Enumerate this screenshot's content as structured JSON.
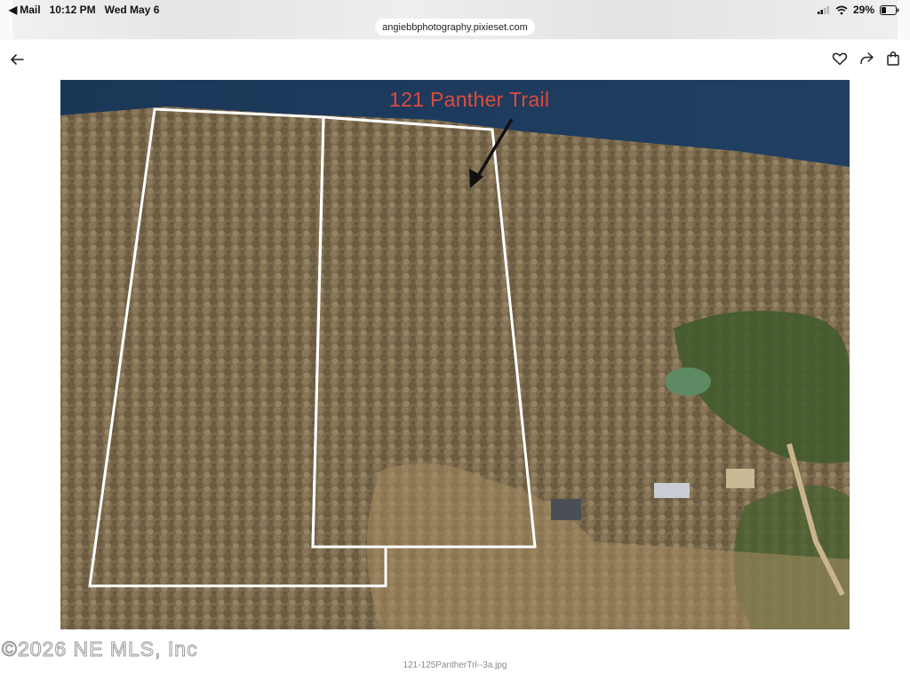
{
  "status_bar": {
    "back_app": "Mail",
    "time": "10:12 PM",
    "date": "Wed May 6",
    "battery": "29%"
  },
  "browser": {
    "url": "angiebbphotography.pixieset.com"
  },
  "icons": {
    "back": "arrow-left-icon",
    "favorite": "heart-icon",
    "share": "share-arrow-icon",
    "cart": "shopping-bag-icon"
  },
  "photo": {
    "overlay_label": "121 Panther Trail",
    "watermark": "©2026 NE MLS, Inc",
    "filename": "121-125PantherTrl--3a.jpg",
    "colors": {
      "water": "#1c3a5c",
      "forest": "#7d6c4f",
      "label": "#e14a3a",
      "boundary": "#ffffff"
    }
  }
}
